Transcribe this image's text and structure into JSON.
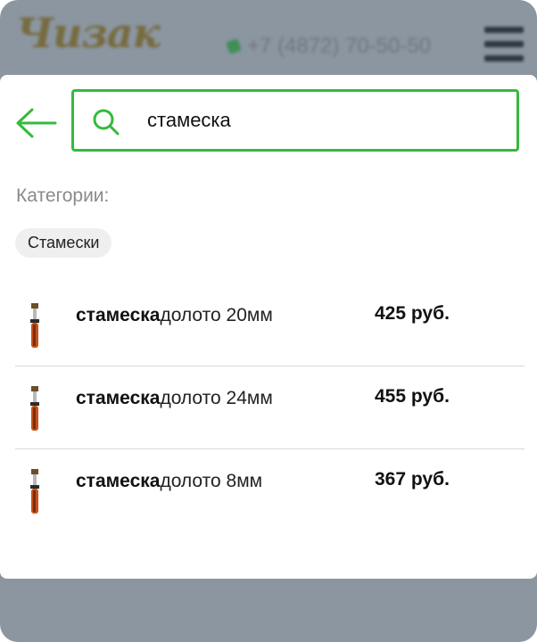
{
  "header": {
    "logo_text": "Чизак",
    "phone": "+7 (4872) 70-50-50"
  },
  "search": {
    "query": "стамеска",
    "placeholder": ""
  },
  "categories": {
    "label": "Категории:",
    "items": [
      "Стамески"
    ]
  },
  "results": [
    {
      "highlight": "стамеска",
      "rest": "долото 20мм",
      "price": "425 руб."
    },
    {
      "highlight": "стамеска",
      "rest": "долото 24мм",
      "price": "455 руб."
    },
    {
      "highlight": "стамеска",
      "rest": "долото 8мм",
      "price": "367 руб."
    }
  ],
  "colors": {
    "accent": "#35ba3d",
    "overlay": "#8c96a1"
  }
}
